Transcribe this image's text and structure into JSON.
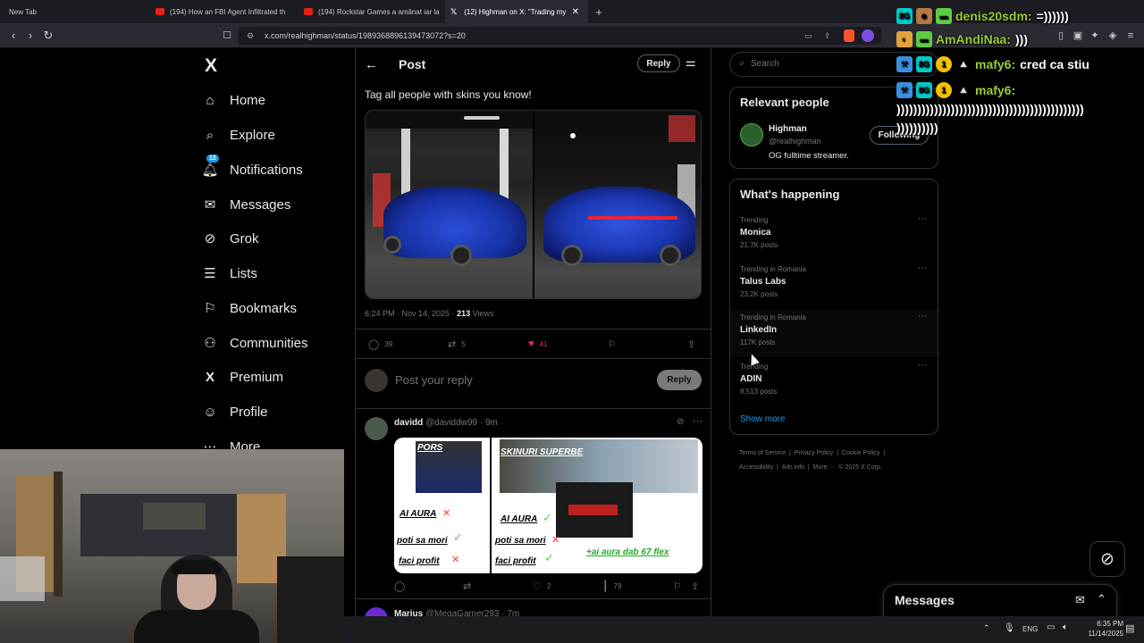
{
  "browser": {
    "tabs": [
      {
        "label": "New Tab",
        "favicon": "none"
      },
      {
        "label": "(194) How an FBI Agent Infiltrated th",
        "favicon": "youtube"
      },
      {
        "label": "(194) Rockstar Games a amânat iar la",
        "favicon": "youtube"
      },
      {
        "label": "(12) Highman on X: \"Trading my",
        "favicon": "x"
      }
    ],
    "new_tab_symbol": "+",
    "url": "x.com/realhighman/status/1989368896139473072?s=20"
  },
  "sidebar": {
    "logo": "X",
    "notification_count": "12",
    "items": [
      {
        "label": "Home",
        "icon": "home-icon"
      },
      {
        "label": "Explore",
        "icon": "search-icon"
      },
      {
        "label": "Notifications",
        "icon": "bell-icon"
      },
      {
        "label": "Messages",
        "icon": "mail-icon"
      },
      {
        "label": "Grok",
        "icon": "grok-icon"
      },
      {
        "label": "Lists",
        "icon": "list-icon"
      },
      {
        "label": "Bookmarks",
        "icon": "bookmark-icon"
      },
      {
        "label": "Communities",
        "icon": "communities-icon"
      },
      {
        "label": "Premium",
        "icon": "x-premium-icon"
      },
      {
        "label": "Profile",
        "icon": "person-icon"
      },
      {
        "label": "More",
        "icon": "more-icon"
      }
    ]
  },
  "post": {
    "header_title": "Post",
    "reply_button": "Reply",
    "text": "Tag all people with skins you know!",
    "time": "6:24 PM · Nov 14, 2025 · ",
    "views_count": "213",
    "views_label": " Views",
    "replies": "39",
    "reposts": "5",
    "likes": "41",
    "reply_placeholder": "Post your reply",
    "reply_submit": "Reply"
  },
  "reply_post": {
    "name": "davidd",
    "handle": "@daviddw99 · 9m",
    "meme_texts": [
      "PORS",
      "SKINURI SUPERBE",
      "AI AURA",
      "AI AURA",
      "poti sa mori",
      "poti sa mori",
      "faci profit",
      "faci profit",
      "+ai aura dab 67 flex"
    ],
    "replies": "",
    "reposts": "",
    "likes": "2",
    "views": "79"
  },
  "next_post": {
    "name": "Marius",
    "handle": "@MegaGamer293 · 7m"
  },
  "search": {
    "placeholder": "Search"
  },
  "relevant": {
    "title": "Relevant people",
    "name": "Highman",
    "handle": "@realhighman",
    "bio": "OG fulltime streamer.",
    "follow_label": "Following"
  },
  "happening": {
    "title": "What's happening",
    "trends": [
      {
        "context": "Trending",
        "name": "Monica",
        "posts": "21.7K posts"
      },
      {
        "context": "Trending in Romania",
        "name": "Talus Labs",
        "posts": "23.2K posts"
      },
      {
        "context": "Trending in Romania",
        "name": "LinkedIn",
        "posts": "117K posts"
      },
      {
        "context": "Trending",
        "name": "ADIN",
        "posts": "8,513 posts"
      }
    ],
    "show_more": "Show more"
  },
  "footer_links": [
    "Terms of Service",
    "|",
    "Privacy Policy",
    "|",
    "Cookie Policy",
    "|",
    "Accessibility",
    "|",
    "Ads info",
    "|",
    "More ···",
    "© 2025 X Corp."
  ],
  "messages_drawer": {
    "title": "Messages"
  },
  "chat": [
    {
      "user": "denis20sdm:",
      "message": "=))))))",
      "color": "#9acd32"
    },
    {
      "user": "AmAndiNaa:",
      "message": ")))",
      "color": "#9acd32"
    },
    {
      "user": "mafy6:",
      "message": "cred ca stiu",
      "color": "#9acd32"
    },
    {
      "user": "mafy6:",
      "message": "",
      "color": "#9acd32"
    }
  ],
  "chat_spam": [
    ")))))))))))))))))))))))))))))))))))))))))))))",
    "))))))))))"
  ],
  "taskbar": {
    "lang": "ENG",
    "time": "6:35 PM",
    "date": "11/14/2025"
  }
}
